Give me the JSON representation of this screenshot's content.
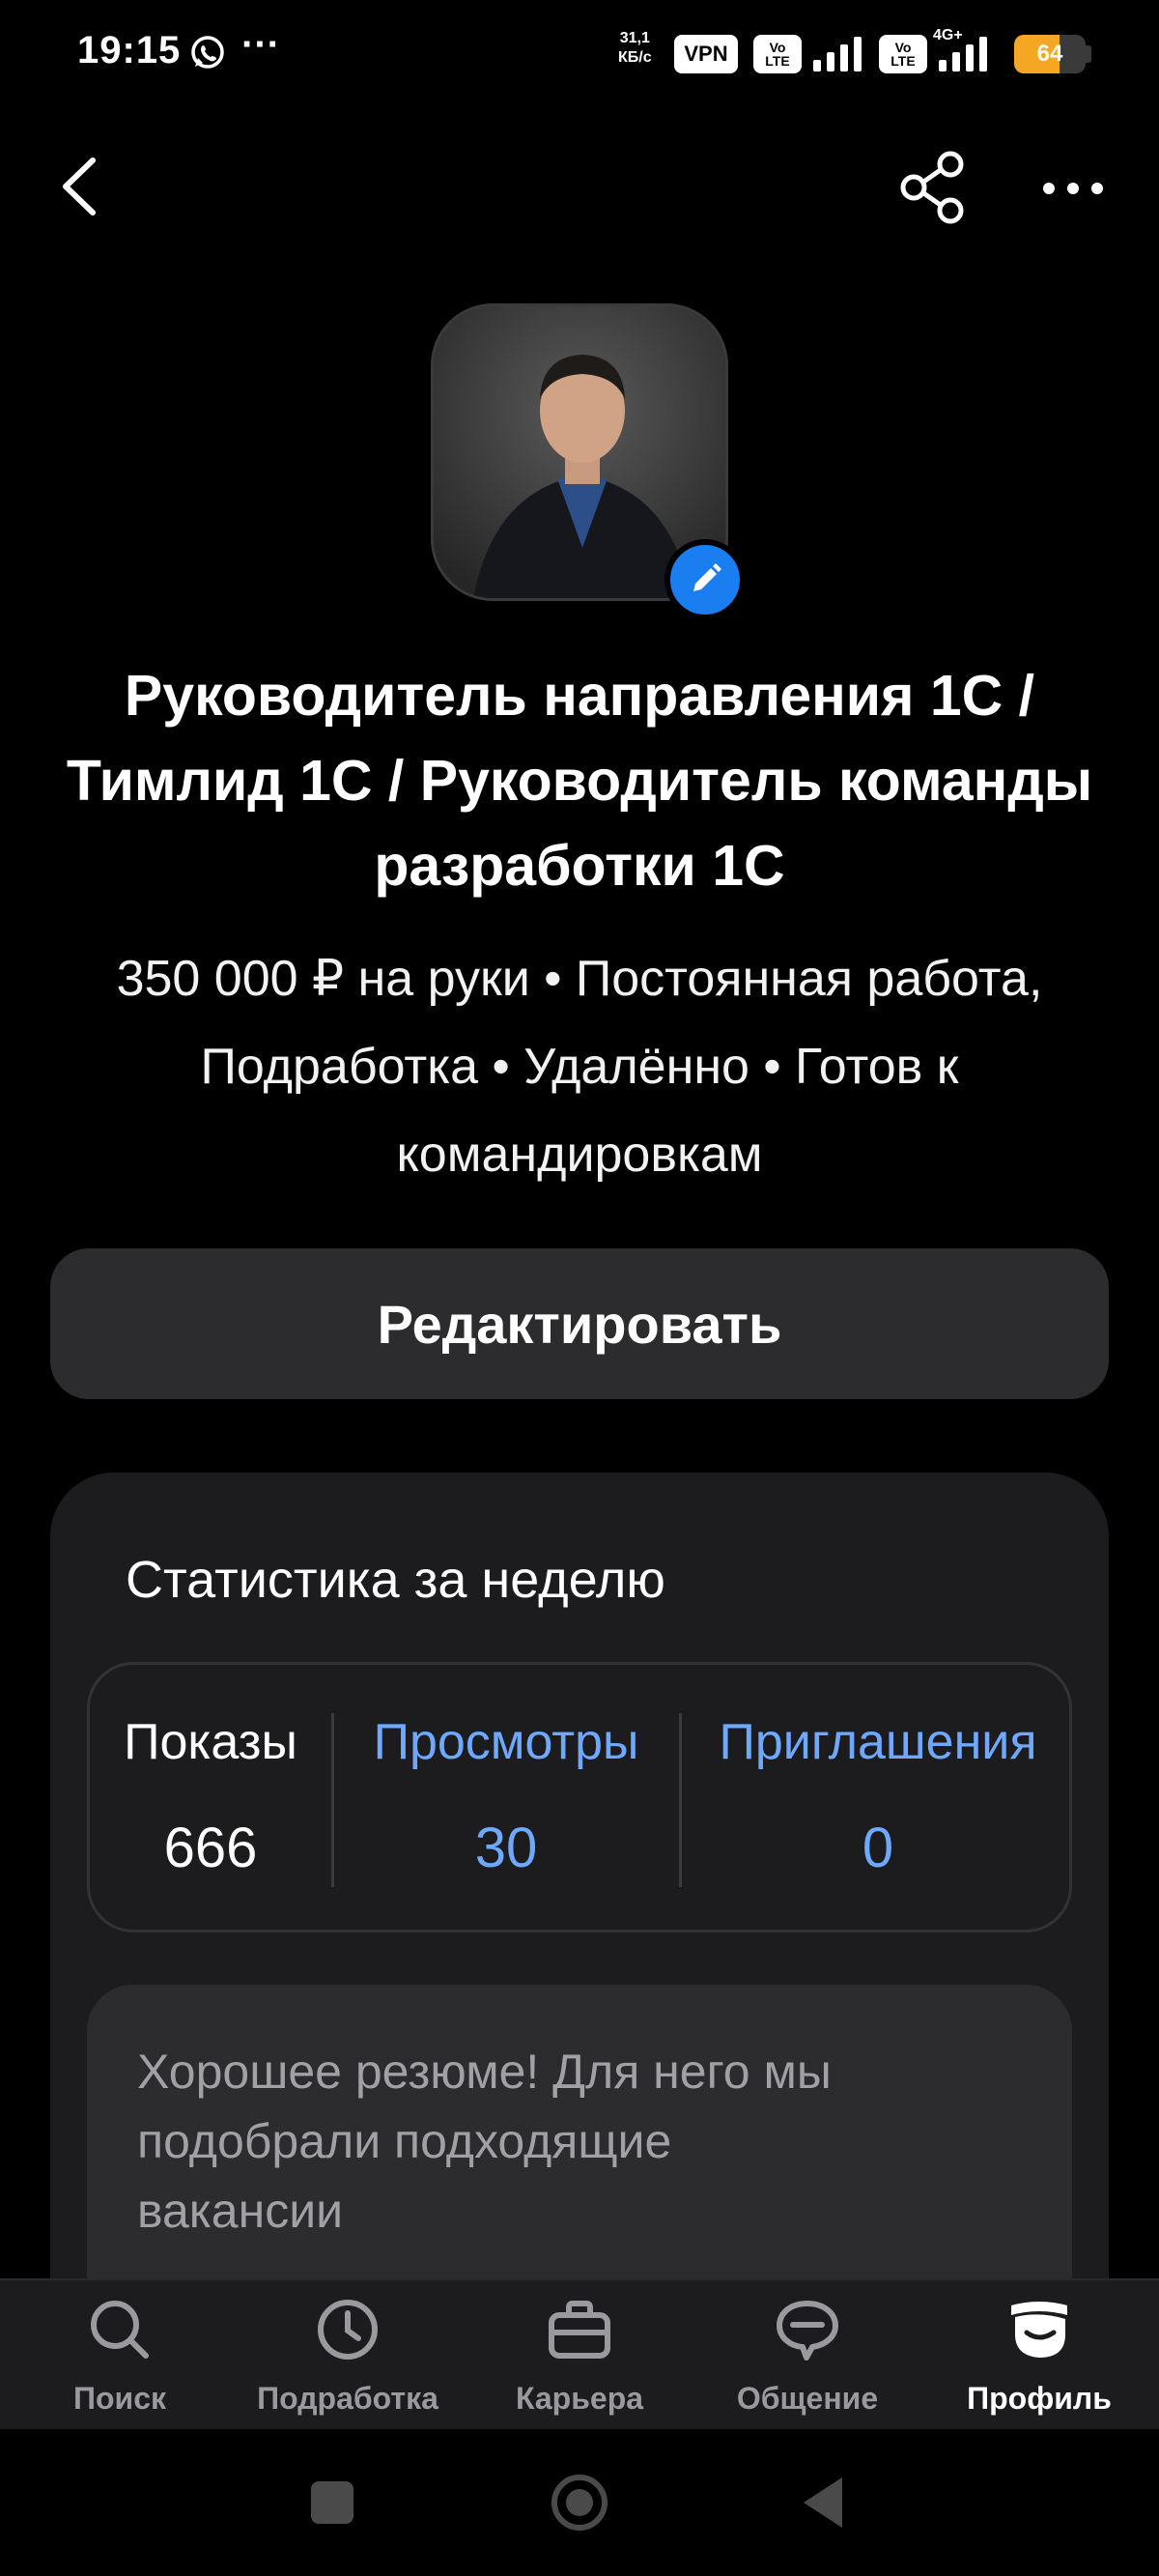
{
  "status_bar": {
    "time": "19:15",
    "speed_value": "31,1",
    "speed_unit": "КБ/с",
    "vpn": "VPN",
    "volte_top": "Vo",
    "volte_bottom": "LTE",
    "network_type": "4G+",
    "battery": "64",
    "battery_level": 0.64
  },
  "header": {
    "back_icon": "chevron-left-icon",
    "share_icon": "share-icon",
    "more_icon": "more-horizontal-icon"
  },
  "profile": {
    "title": "Руководитель направления 1С / Тимлид 1С / Руководитель команды разработки 1С",
    "subtitle": "350 000 ₽ на руки • Постоянная работа, Подработка • Удалённо • Готов к командировкам",
    "edit_label": "Редактировать"
  },
  "stats": {
    "title": "Статистика за неделю",
    "items": [
      {
        "label": "Показы",
        "value": "666"
      },
      {
        "label": "Просмотры",
        "value": "30"
      },
      {
        "label": "Приглашения",
        "value": "0"
      }
    ],
    "tip": "Хорошее резюме! Для него мы подобрали подходящие вакансии"
  },
  "bottom_nav": {
    "items": [
      {
        "label": "Поиск",
        "icon": "search-icon"
      },
      {
        "label": "Подработка",
        "icon": "clock-icon"
      },
      {
        "label": "Карьера",
        "icon": "briefcase-icon"
      },
      {
        "label": "Общение",
        "icon": "chat-icon"
      },
      {
        "label": "Профиль",
        "icon": "profile-icon"
      }
    ],
    "active": "Профиль"
  },
  "colors": {
    "accent": "#1a7df0",
    "link": "#6fa8ff",
    "battery": "#f5a623",
    "background": "#000000",
    "card": "#1c1c1e"
  }
}
